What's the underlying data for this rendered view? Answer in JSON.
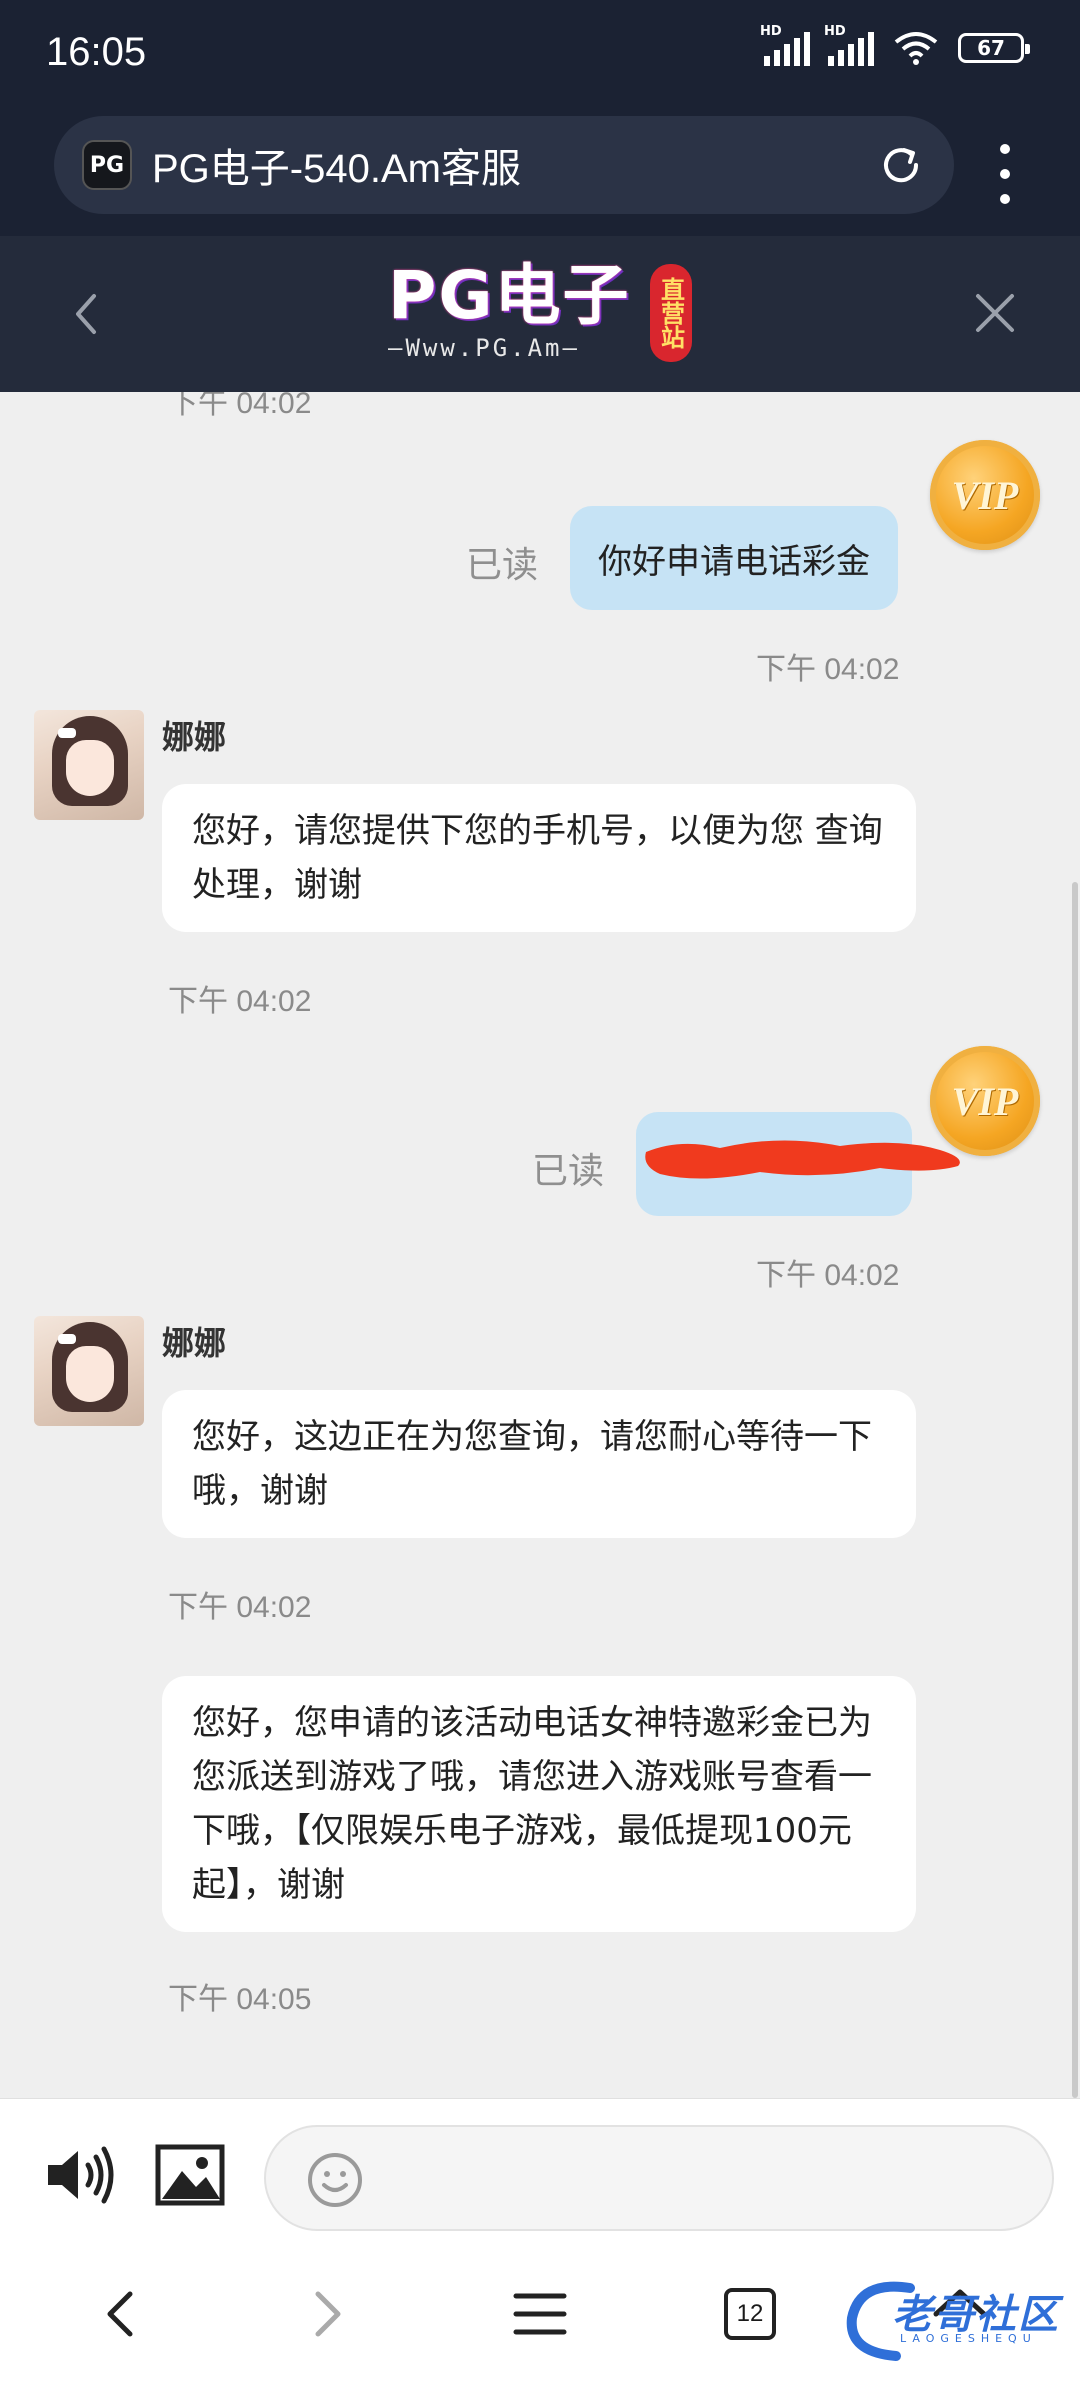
{
  "status_bar": {
    "time": "16:05",
    "battery": "67",
    "signal1_label": "HD",
    "signal2_label": "HD"
  },
  "browser": {
    "site_icon": "PG",
    "url_title": "PG电子-540.Am客服",
    "tab_count": "12"
  },
  "header": {
    "logo_main": "PG电子",
    "logo_sub": "—Www.PG.Am—",
    "logo_badge": "直营站"
  },
  "chat": {
    "top_partial_time": "下午 04:02",
    "messages": [
      {
        "type": "out",
        "read": "已读",
        "text": "你好申请电话彩金",
        "time": "下午 04:02",
        "badge": "VIP"
      },
      {
        "type": "in",
        "sender": "娜娜",
        "text": "您好，请您提供下您的手机号，以便为您 查询处理，谢谢",
        "time": "下午 04:02"
      },
      {
        "type": "out",
        "read": "已读",
        "text": "",
        "time": "下午 04:02",
        "badge": "VIP",
        "redacted": true
      },
      {
        "type": "in",
        "sender": "娜娜",
        "text": "您好，这边正在为您查询，请您耐心等待一下哦，谢谢",
        "time": "下午 04:02"
      },
      {
        "type": "in",
        "text": "您好，您申请的该活动电话女神特邀彩金已为您派送到游戏了哦，请您进入游戏账号查看一下哦，【仅限娱乐电子游戏，最低提现100元起】，谢谢",
        "time": "下午 04:05"
      }
    ]
  },
  "input_bar": {
    "placeholder": ""
  },
  "watermark": {
    "text": "老哥社区",
    "sub": "LAOGESHEQU"
  },
  "colors": {
    "chrome": "#1b2233",
    "header": "#242b3b",
    "bubble_out": "#c6e3f5",
    "bubble_in": "#ffffff",
    "vip": "#f5a623",
    "redaction": "#f03a1e"
  },
  "icons": [
    "back-icon",
    "close-icon",
    "reload-icon",
    "more-vert-icon",
    "speaker-icon",
    "image-icon",
    "emoji-icon",
    "nav-back-icon",
    "nav-forward-icon",
    "nav-menu-icon",
    "nav-home-icon"
  ]
}
